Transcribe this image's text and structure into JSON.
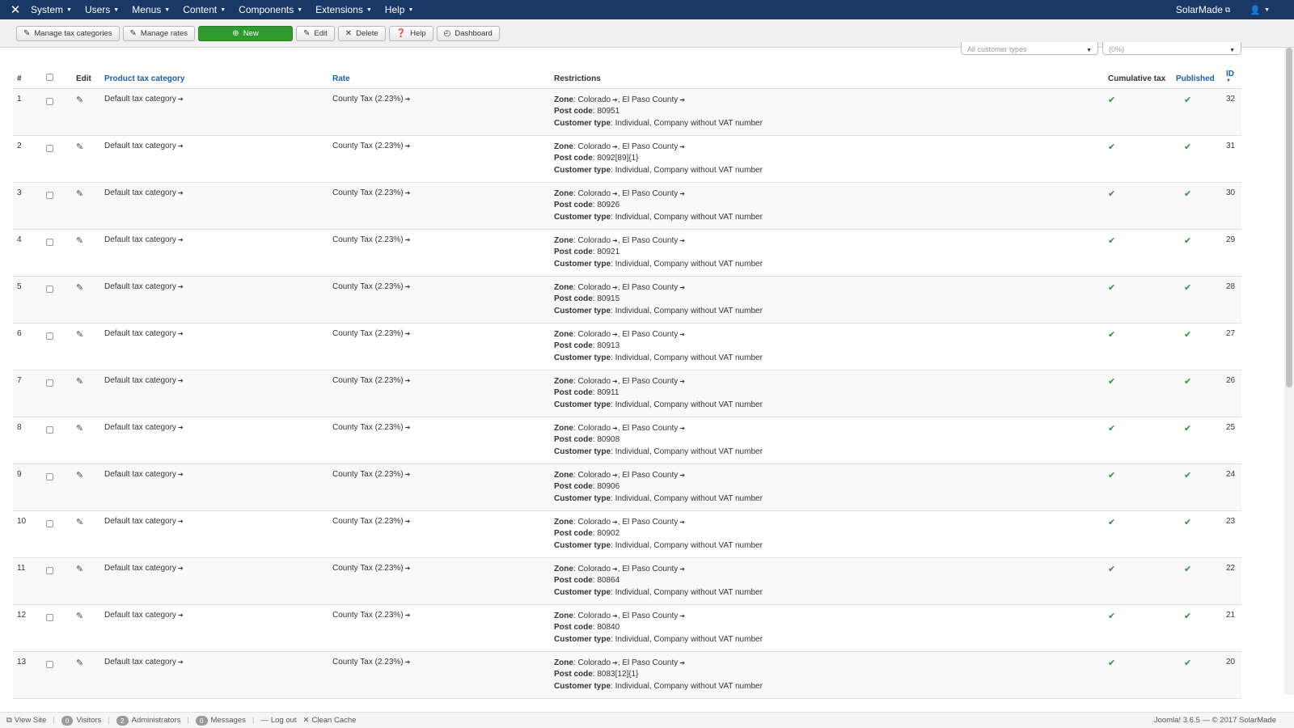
{
  "topbar": {
    "menu": [
      "System",
      "Users",
      "Menus",
      "Content",
      "Components",
      "Extensions",
      "Help"
    ],
    "site_name": "SolarMade"
  },
  "toolbar": {
    "manage_tax_categories": "Manage tax categories",
    "manage_rates": "Manage rates",
    "new": "New",
    "edit": "Edit",
    "delete": "Delete",
    "help": "Help",
    "dashboard": "Dashboard"
  },
  "filters": {
    "customer_types": "All customer types",
    "percent": "(0%)"
  },
  "table": {
    "headers": {
      "num": "#",
      "edit": "Edit",
      "category": "Product tax category",
      "rate": "Rate",
      "restrictions": "Restrictions",
      "cumulative": "Cumulative tax",
      "published": "Published",
      "id": "ID"
    },
    "labels": {
      "zone": "Zone",
      "post_code": "Post code",
      "customer_type": "Customer type"
    },
    "rows": [
      {
        "num": "1",
        "category": "Default tax category",
        "rate": "County Tax (2.23%)",
        "zone_a": "Colorado",
        "zone_b": "El Paso County",
        "post_code": "80951",
        "customer_type": "Individual, Company without VAT number",
        "id": "32"
      },
      {
        "num": "2",
        "category": "Default tax category",
        "rate": "County Tax (2.23%)",
        "zone_a": "Colorado",
        "zone_b": "El Paso County",
        "post_code": "8092[89]{1}",
        "customer_type": "Individual, Company without VAT number",
        "id": "31"
      },
      {
        "num": "3",
        "category": "Default tax category",
        "rate": "County Tax (2.23%)",
        "zone_a": "Colorado",
        "zone_b": "El Paso County",
        "post_code": "80926",
        "customer_type": "Individual, Company without VAT number",
        "id": "30"
      },
      {
        "num": "4",
        "category": "Default tax category",
        "rate": "County Tax (2.23%)",
        "zone_a": "Colorado",
        "zone_b": "El Paso County",
        "post_code": "80921",
        "customer_type": "Individual, Company without VAT number",
        "id": "29"
      },
      {
        "num": "5",
        "category": "Default tax category",
        "rate": "County Tax (2.23%)",
        "zone_a": "Colorado",
        "zone_b": "El Paso County",
        "post_code": "80915",
        "customer_type": "Individual, Company without VAT number",
        "id": "28"
      },
      {
        "num": "6",
        "category": "Default tax category",
        "rate": "County Tax (2.23%)",
        "zone_a": "Colorado",
        "zone_b": "El Paso County",
        "post_code": "80913",
        "customer_type": "Individual, Company without VAT number",
        "id": "27"
      },
      {
        "num": "7",
        "category": "Default tax category",
        "rate": "County Tax (2.23%)",
        "zone_a": "Colorado",
        "zone_b": "El Paso County",
        "post_code": "80911",
        "customer_type": "Individual, Company without VAT number",
        "id": "26"
      },
      {
        "num": "8",
        "category": "Default tax category",
        "rate": "County Tax (2.23%)",
        "zone_a": "Colorado",
        "zone_b": "El Paso County",
        "post_code": "80908",
        "customer_type": "Individual, Company without VAT number",
        "id": "25"
      },
      {
        "num": "9",
        "category": "Default tax category",
        "rate": "County Tax (2.23%)",
        "zone_a": "Colorado",
        "zone_b": "El Paso County",
        "post_code": "80906",
        "customer_type": "Individual, Company without VAT number",
        "id": "24"
      },
      {
        "num": "10",
        "category": "Default tax category",
        "rate": "County Tax (2.23%)",
        "zone_a": "Colorado",
        "zone_b": "El Paso County",
        "post_code": "80902",
        "customer_type": "Individual, Company without VAT number",
        "id": "23"
      },
      {
        "num": "11",
        "category": "Default tax category",
        "rate": "County Tax (2.23%)",
        "zone_a": "Colorado",
        "zone_b": "El Paso County",
        "post_code": "80864",
        "customer_type": "Individual, Company without VAT number",
        "id": "22"
      },
      {
        "num": "12",
        "category": "Default tax category",
        "rate": "County Tax (2.23%)",
        "zone_a": "Colorado",
        "zone_b": "El Paso County",
        "post_code": "80840",
        "customer_type": "Individual, Company without VAT number",
        "id": "21"
      },
      {
        "num": "13",
        "category": "Default tax category",
        "rate": "County Tax (2.23%)",
        "zone_a": "Colorado",
        "zone_b": "El Paso County",
        "post_code": "8083[12]{1}",
        "customer_type": "Individual, Company without VAT number",
        "id": "20"
      }
    ]
  },
  "statusbar": {
    "view_site": "View Site",
    "visitors_count": "0",
    "visitors": "Visitors",
    "admins_count": "2",
    "admins": "Administrators",
    "messages_count": "0",
    "messages": "Messages",
    "logout": "Log out",
    "clean_cache": "Clean Cache",
    "version": "Joomla! 3.6.5 — © 2017 SolarMade"
  }
}
